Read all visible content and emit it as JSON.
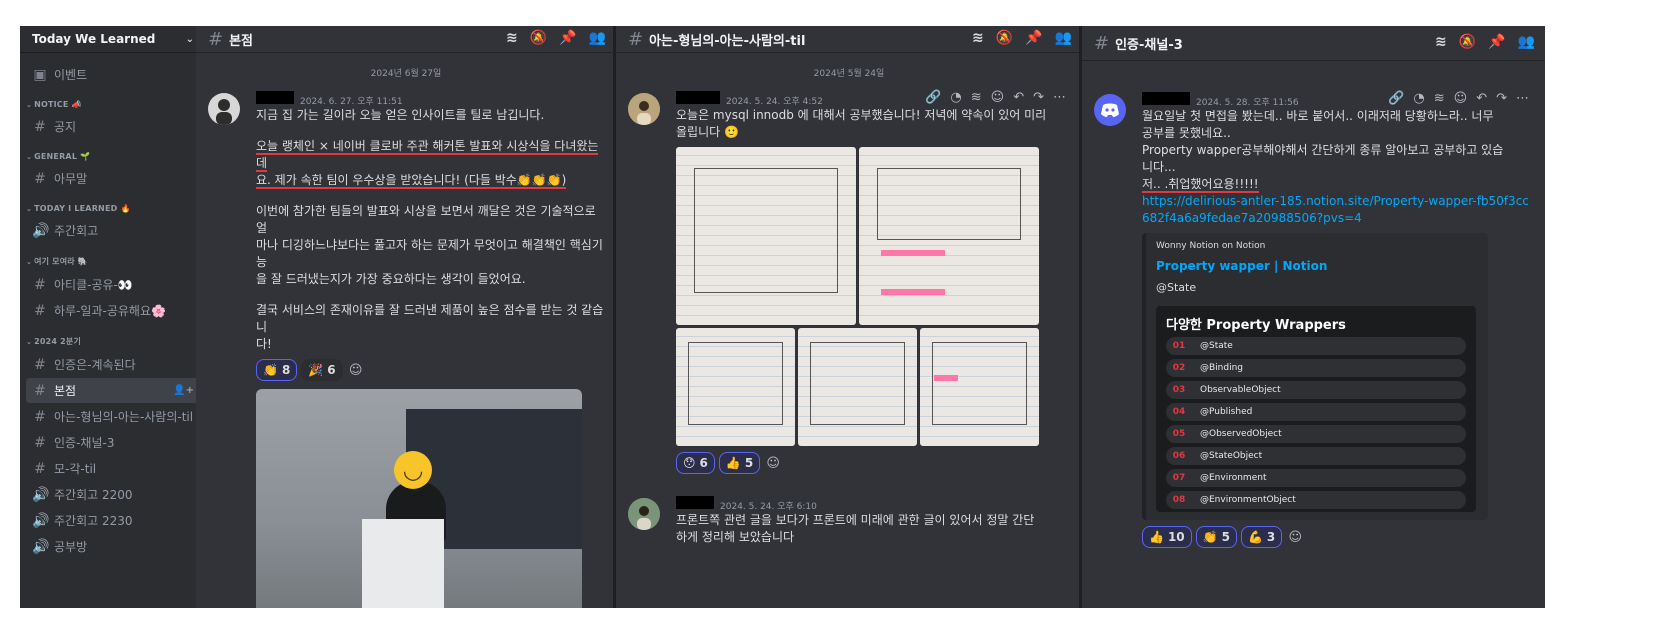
{
  "sidebar": {
    "server_name": "Today We Learned",
    "events_label": "이벤트",
    "sections": [
      {
        "category": "NOTICE 📣",
        "channels": [
          {
            "label": "공지",
            "icon": "hash-icon"
          }
        ]
      },
      {
        "category": "GENERAL 🌱",
        "channels": [
          {
            "label": "아무말",
            "icon": "hash-icon"
          }
        ]
      },
      {
        "category": "TODAY I LEARNED 🔥",
        "channels": [
          {
            "label": "주간회고",
            "icon": "speaker-icon"
          }
        ]
      },
      {
        "category": "여기 모여라 🐘",
        "channels": [
          {
            "label": "아티클-공유-👀",
            "icon": "hash-icon"
          },
          {
            "label": "하루-일과-공유해요🌸",
            "icon": "hash-icon"
          }
        ]
      },
      {
        "category": "2024 2분기",
        "channels": [
          {
            "label": "인증은-계속된다",
            "icon": "hash-icon"
          },
          {
            "label": "본점",
            "icon": "hash-icon",
            "active": true
          },
          {
            "label": "아는-형님의-아는-사람의-til",
            "icon": "hash-icon"
          },
          {
            "label": "인증-채널-3",
            "icon": "hash-icon"
          },
          {
            "label": "모-각-til",
            "icon": "hash-icon"
          },
          {
            "label": "주간회고 2200",
            "icon": "speaker-icon"
          },
          {
            "label": "주간회고 2230",
            "icon": "speaker-icon"
          },
          {
            "label": "공부방",
            "icon": "speaker-icon"
          }
        ]
      }
    ]
  },
  "pane1": {
    "channel": "본점",
    "date_divider": "2024년 6월 27일",
    "message": {
      "timestamp": "2024. 6. 27. 오후 11:51",
      "line1": "지금 집 가는 길이라 오늘 얻은 인사이트를 틸로 남깁니다.",
      "line2a": "오늘 랭체인 × 네이버 클로바 주관 해커톤 발표와 시상식을 다녀왔는데",
      "line2b": "요. 제가 속한 팀이 우수상을 받았습니다! (다들 박수👏👏👏)",
      "line3": "이번에 참가한 팀들의 발표와 시상을 보면서 깨달은 것은 기술적으로 얼\n마나 디깅하느냐보다는 풀고자 하는 문제가 무엇이고 해결책인 핵심기능\n을 잘 드러냈는지가 가장 중요하다는 생각이 들었어요.",
      "line4": "결국 서비스의 존재이유를 잘 드러낸 제품이 높은 점수를 받는 것 같습니\n다!",
      "reactions": [
        {
          "emoji": "👏",
          "count": "8"
        },
        {
          "emoji": "🎉",
          "count": "6"
        }
      ]
    }
  },
  "pane2": {
    "channel": "아는-형님의-아는-사람의-til",
    "date_divider": "2024년 5월 24일",
    "message1": {
      "timestamp": "2024. 5. 24. 오후 4:52",
      "text": "오늘은 mysql innodb 에 대해서 공부했습니다! 저녁에 약속이 있어 미리\n올립니다 🙂",
      "reactions": [
        {
          "emoji": "😯",
          "count": "6"
        },
        {
          "emoji": "👍",
          "count": "5"
        }
      ]
    },
    "message2": {
      "timestamp": "2024. 5. 24. 오후 6:10",
      "text": "프론트쪽 관련 글을 보다가 프론트에 미래에 관한 글이 있어서 정말 간단\n하게 정리해 보았습니다"
    }
  },
  "pane3": {
    "channel": "인증-채널-3",
    "message": {
      "timestamp": "2024. 5. 28. 오후 11:56",
      "text": "월요일날 첫 면접을 봤는데.. 바로 붙어서.. 이래저래 당황하느라.. 너무\n공부를 못했네요..\nProperty wapper공부해야해서 간단하게 종류 알아보고 공부하고 있습\n니다...",
      "highlight": "저.. .취업했어요용!!!!!",
      "link": "https://delirious-antler-185.notion.site/Property-wapper-fb50f3cc682f4a6a9fedae7a20988506?pvs=4",
      "embed": {
        "provider": "Wonny Notion on Notion",
        "title": "Property wapper | Notion",
        "description": "@State",
        "image_title": "다양한 Property Wrappers",
        "items": [
          {
            "num": "01",
            "label": "@State"
          },
          {
            "num": "02",
            "label": "@Binding"
          },
          {
            "num": "03",
            "label": "ObservableObject"
          },
          {
            "num": "04",
            "label": "@Published"
          },
          {
            "num": "05",
            "label": "@ObservedObject"
          },
          {
            "num": "06",
            "label": "@StateObject"
          },
          {
            "num": "07",
            "label": "@Environment"
          },
          {
            "num": "08",
            "label": "@EnvironmentObject"
          }
        ]
      },
      "reactions": [
        {
          "emoji": "👍",
          "count": "10"
        },
        {
          "emoji": "👏",
          "count": "5"
        },
        {
          "emoji": "💪",
          "count": "3"
        }
      ]
    }
  }
}
